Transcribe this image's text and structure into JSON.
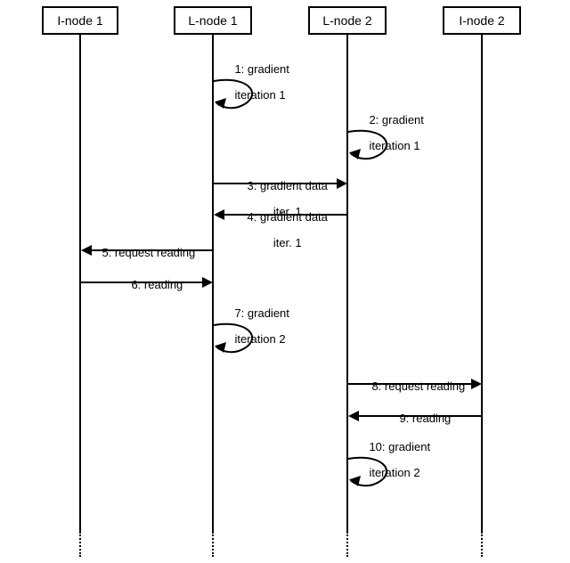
{
  "participants": {
    "p1": "I-node 1",
    "p2": "L-node 1",
    "p3": "L-node 2",
    "p4": "I-node 2"
  },
  "messages": {
    "m1_l1": "1: gradient",
    "m1_l2": "iteration 1",
    "m2_l1": "2: gradient",
    "m2_l2": "iteration 1",
    "m3_l1": "3: gradient data",
    "m3_l2": "iter. 1",
    "m4_l1": "4: gradient data",
    "m4_l2": "iter. 1",
    "m5": "5: request reading",
    "m6": "6: reading",
    "m7_l1": "7: gradient",
    "m7_l2": "iteration 2",
    "m8": "8: request reading",
    "m9": "9: reading",
    "m10_l1": "10: gradient",
    "m10_l2": "iteration 2"
  },
  "chart_data": {
    "type": "sequence-diagram",
    "participants": [
      "I-node 1",
      "L-node 1",
      "L-node 2",
      "I-node 2"
    ],
    "messages": [
      {
        "seq": 1,
        "from": "L-node 1",
        "to": "L-node 1",
        "label": "gradient iteration 1",
        "kind": "self"
      },
      {
        "seq": 2,
        "from": "L-node 2",
        "to": "L-node 2",
        "label": "gradient iteration 1",
        "kind": "self"
      },
      {
        "seq": 3,
        "from": "L-node 1",
        "to": "L-node 2",
        "label": "gradient data iter. 1",
        "kind": "async"
      },
      {
        "seq": 4,
        "from": "L-node 2",
        "to": "L-node 1",
        "label": "gradient data iter. 1",
        "kind": "async"
      },
      {
        "seq": 5,
        "from": "L-node 1",
        "to": "I-node 1",
        "label": "request reading",
        "kind": "async"
      },
      {
        "seq": 6,
        "from": "I-node 1",
        "to": "L-node 1",
        "label": "reading",
        "kind": "async"
      },
      {
        "seq": 7,
        "from": "L-node 1",
        "to": "L-node 1",
        "label": "gradient iteration 2",
        "kind": "self"
      },
      {
        "seq": 8,
        "from": "L-node 2",
        "to": "I-node 2",
        "label": "request reading",
        "kind": "async"
      },
      {
        "seq": 9,
        "from": "I-node 2",
        "to": "L-node 2",
        "label": "reading",
        "kind": "async"
      },
      {
        "seq": 10,
        "from": "L-node 2",
        "to": "L-node 2",
        "label": "gradient iteration 2",
        "kind": "self"
      }
    ]
  }
}
